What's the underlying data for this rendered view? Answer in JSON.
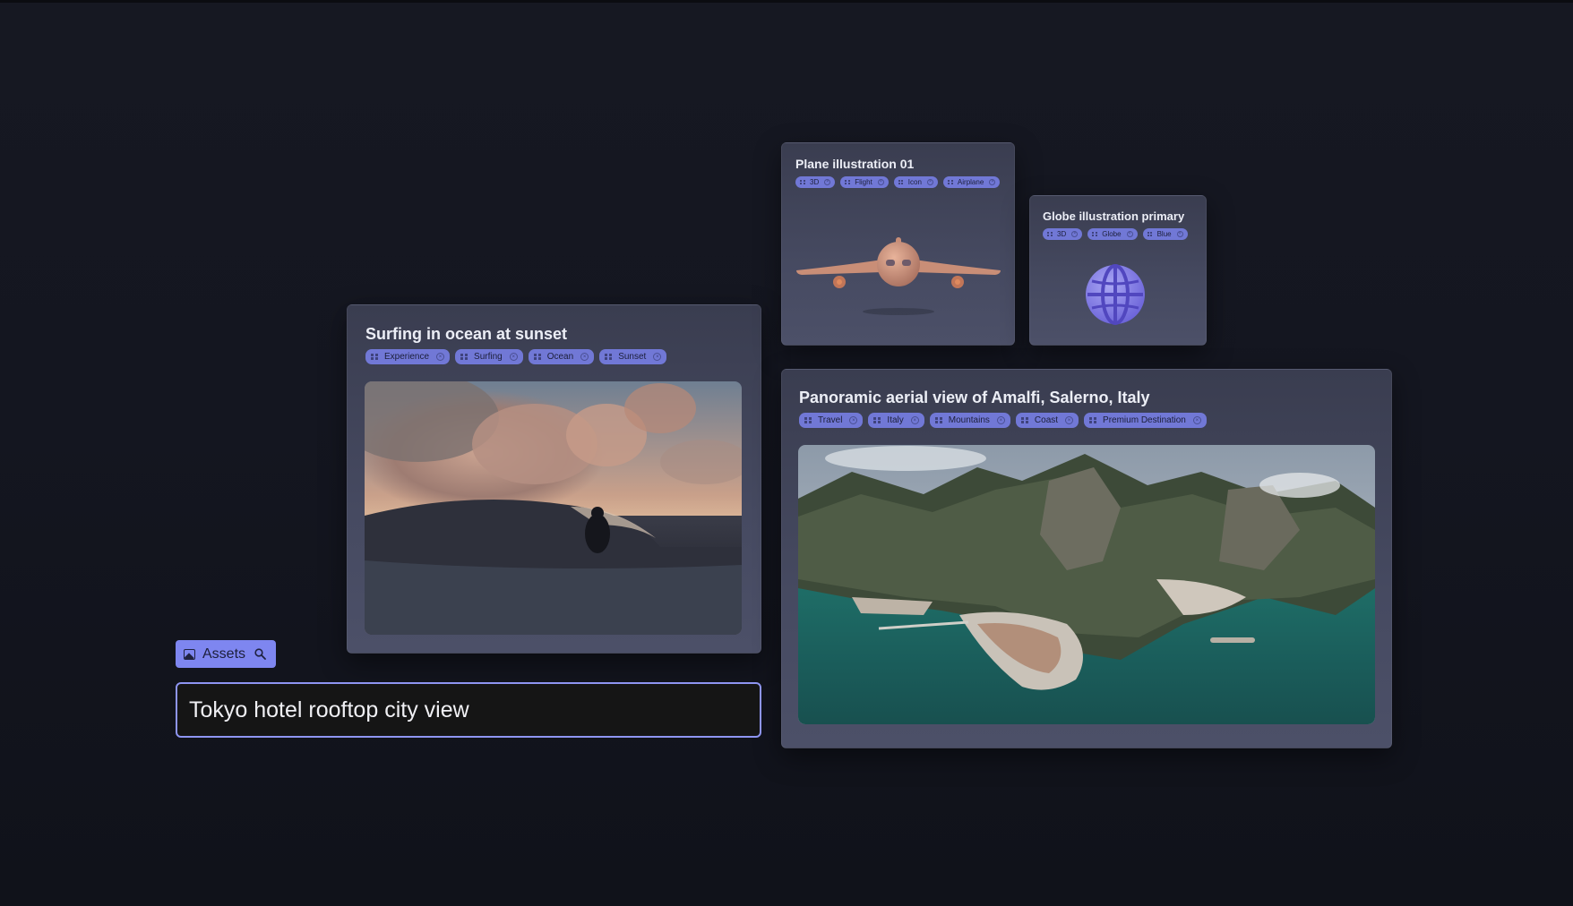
{
  "cards": {
    "surfing": {
      "title": "Surfing in ocean at sunset",
      "tags": [
        "Experience",
        "Surfing",
        "Ocean",
        "Sunset"
      ]
    },
    "plane": {
      "title": "Plane illustration 01",
      "tags": [
        "3D",
        "Flight",
        "Icon",
        "Airplane"
      ]
    },
    "globe": {
      "title": "Globe illustration primary",
      "tags": [
        "3D",
        "Globe",
        "Blue"
      ]
    },
    "amalfi": {
      "title": "Panoramic aerial view of Amalfi, Salerno, Italy",
      "tags": [
        "Travel",
        "Italy",
        "Mountains",
        "Coast",
        "Premium Destination"
      ]
    }
  },
  "assets_chip": {
    "label": "Assets",
    "icon_left": "image-icon",
    "icon_right": "search-icon"
  },
  "search": {
    "value": "Tokyo hotel rooftop city view"
  },
  "icons": {
    "tag_handle": "grid-icon",
    "tag_remove": "close-circle-icon"
  },
  "colors": {
    "accent": "#7e86f0",
    "tag": "#7178d6",
    "card": "#43475d",
    "background": "#141620"
  }
}
